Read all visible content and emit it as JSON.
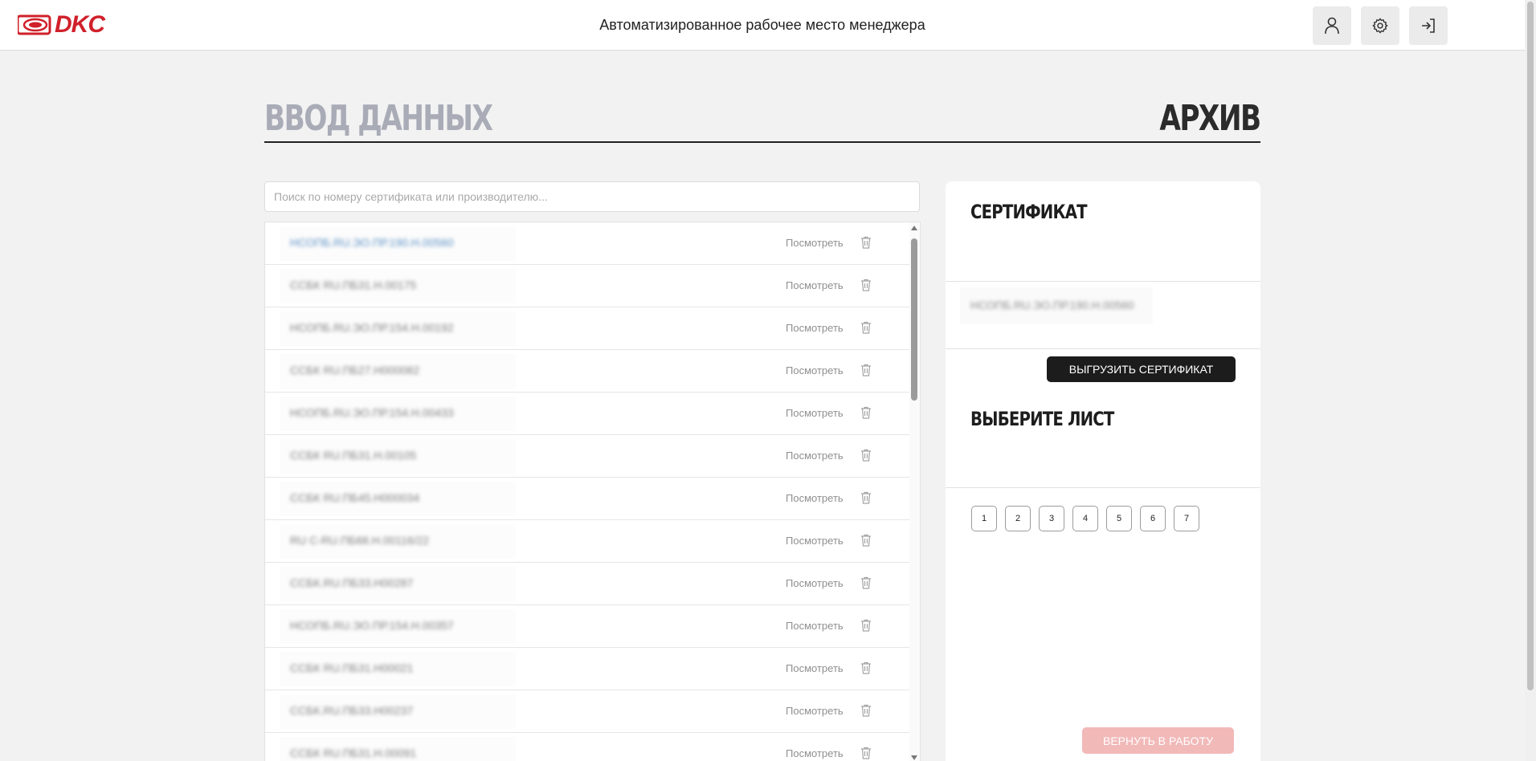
{
  "header": {
    "logo_text": "DKC",
    "title": "Автоматизированное рабочее место менеджера",
    "brand_color": "#d0202a",
    "icons": [
      "user-icon",
      "gear-icon",
      "logout-icon"
    ]
  },
  "tabs": {
    "input_label": "ВВОД ДАННЫХ",
    "archive_label": "АРХИВ",
    "active": "archive"
  },
  "search": {
    "placeholder": "Поиск по номеру сертификата или производителю..."
  },
  "list": {
    "view_label": "Посмотреть",
    "rows": [
      {
        "id": "НСОПБ.RU.ЭО.ПР.190.Н.00560",
        "active": true
      },
      {
        "id": "ССБК RU.ПБ31.Н.00175",
        "active": false
      },
      {
        "id": "НСОПБ.RU.ЭО.ПР.154.Н.00192",
        "active": false
      },
      {
        "id": "ССБК RU.ПБ27.Н000082",
        "active": false
      },
      {
        "id": "НСОПБ.RU.ЭО.ПР.154.Н.00433",
        "active": false
      },
      {
        "id": "ССБК RU.ПБ31.Н.00105",
        "active": false
      },
      {
        "id": "ССБК RU.ПБ45.Н000034",
        "active": false
      },
      {
        "id": "RU С-RU.ПБ68.Н.00116/22",
        "active": false
      },
      {
        "id": "ССБК.RU.ПБ33.Н00287",
        "active": false
      },
      {
        "id": "НСОПБ.RU.ЭО.ПР.154.Н.00357",
        "active": false
      },
      {
        "id": "ССБК RU.ПБ31.Н00021",
        "active": false
      },
      {
        "id": "ССБК.RU.ПБ33.Н00237",
        "active": false
      },
      {
        "id": "ССБК RU.ПБ31.Н.00091",
        "active": false
      }
    ]
  },
  "side": {
    "certificate_title": "СЕРТИФИКАТ",
    "selected_certificate": "НСОПБ.RU.ЭО.ПР.190.Н.00560",
    "export_label": "ВЫГРУЗИТЬ СЕРТИФИКАТ",
    "sheet_title": "ВЫБЕРИТЕ ЛИСТ",
    "sheets": [
      "1",
      "2",
      "3",
      "4",
      "5",
      "6",
      "7"
    ],
    "return_label": "ВЕРНУТЬ В РАБОТУ",
    "return_color": "#f2b9b9"
  }
}
